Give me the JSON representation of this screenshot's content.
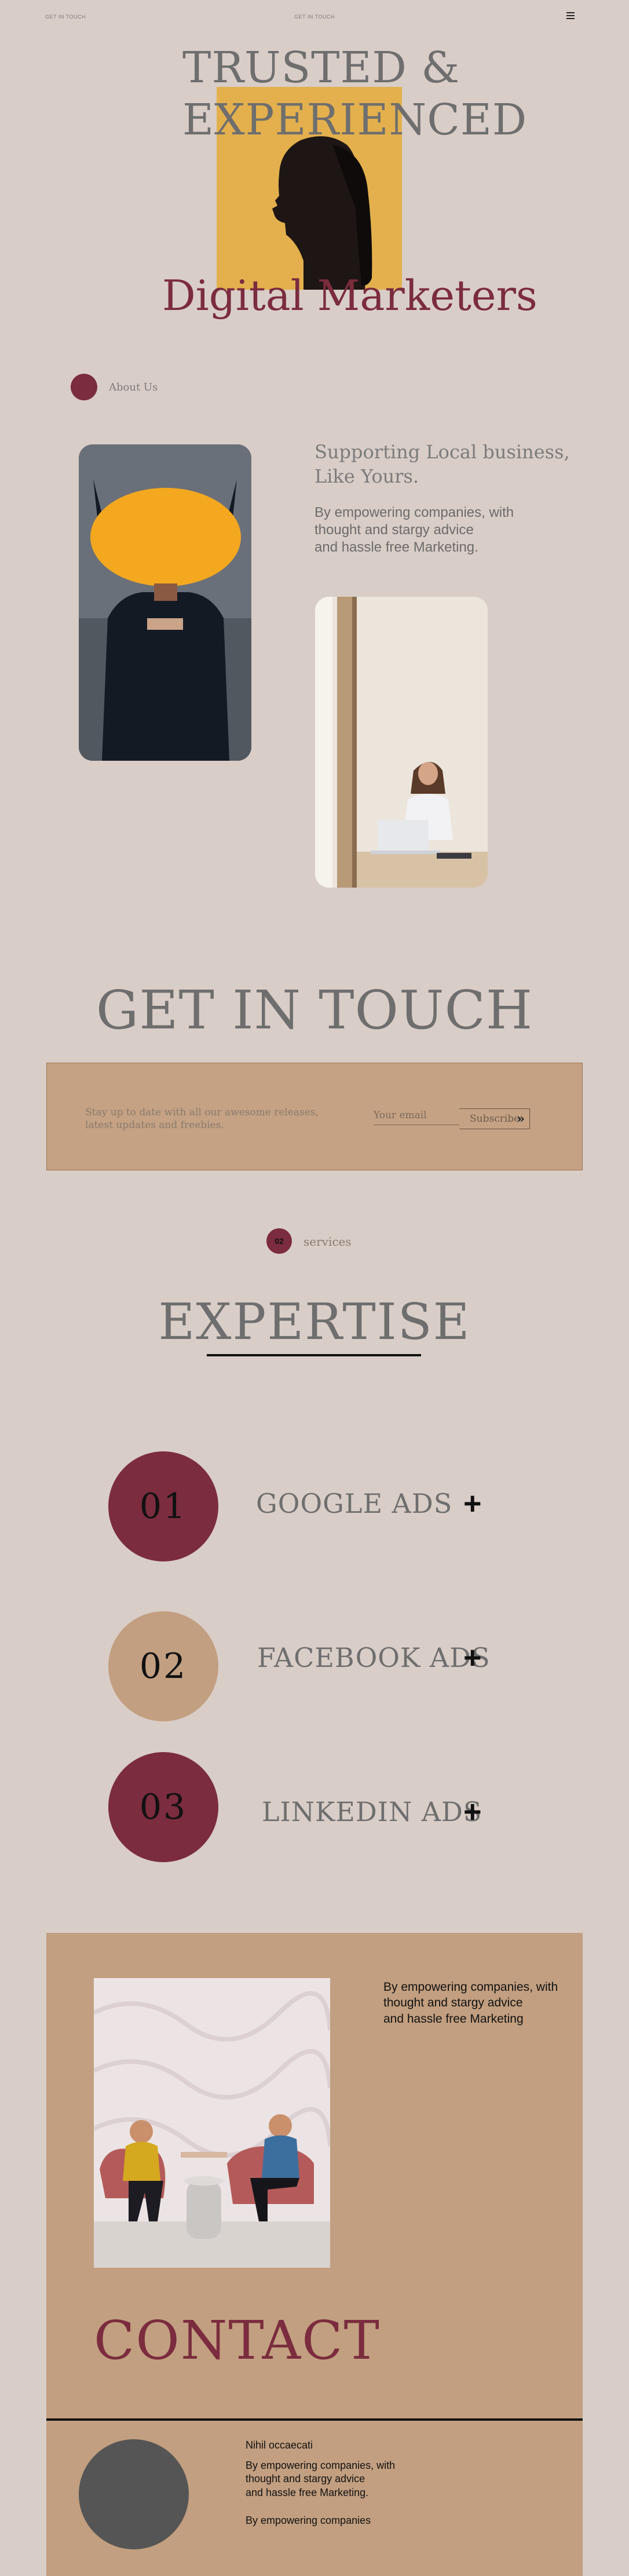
{
  "topbar": {
    "left_label": "GET IN TOUCH",
    "center_label": "GET IN TOUCH"
  },
  "hero": {
    "title_line1": "TRUSTED &",
    "title_line2": "EXPERIENCED",
    "subtitle": "Digital Marketers",
    "image": "woman-profile-portrait"
  },
  "about": {
    "label": "About Us",
    "heading_line1": "Supporting Local business,",
    "heading_line2": "Like Yours.",
    "text_line1": "By empowering  companies, with",
    "text_line2": "thought and stargy advice",
    "text_line3": "and hassle free Marketing."
  },
  "get_in_touch": {
    "title": "GET IN TOUCH",
    "newsletter_line1": "Stay up to date with all our awesome releases,",
    "newsletter_line2": "latest updates and freebies.",
    "email_placeholder": "Your email",
    "subscribe_label": "Subscribe",
    "subscribe_icon": "»"
  },
  "services": {
    "badge": "02",
    "label": "services",
    "title": "EXPERTISE",
    "items": [
      {
        "number": "01",
        "name": "GOOGLE ADS",
        "color": "#7b2c3e"
      },
      {
        "number": "02",
        "name": "FACEBOOK ADS",
        "color": "#c29f80"
      },
      {
        "number": "03",
        "name": "LINKEDIN ADS",
        "color": "#7b2c3e"
      }
    ],
    "expand_icon": "+"
  },
  "contact": {
    "text_line1": "By empowering  companies, with",
    "text_line2": "thought and stargy advice",
    "text_line3": "and hassle free Marketing",
    "title": "CONTACT",
    "name": "Nihil occaecati",
    "bio_line1": "By empowering  companies, with",
    "bio_line2": "thought and stargy advice",
    "bio_line3": "and hassle free Marketing.",
    "bio2": "By empowering  companies"
  },
  "colors": {
    "background": "#d9cdc8",
    "accent": "#7b2c3e",
    "tan": "#c29f80",
    "hero_yellow": "#e3b04d"
  }
}
